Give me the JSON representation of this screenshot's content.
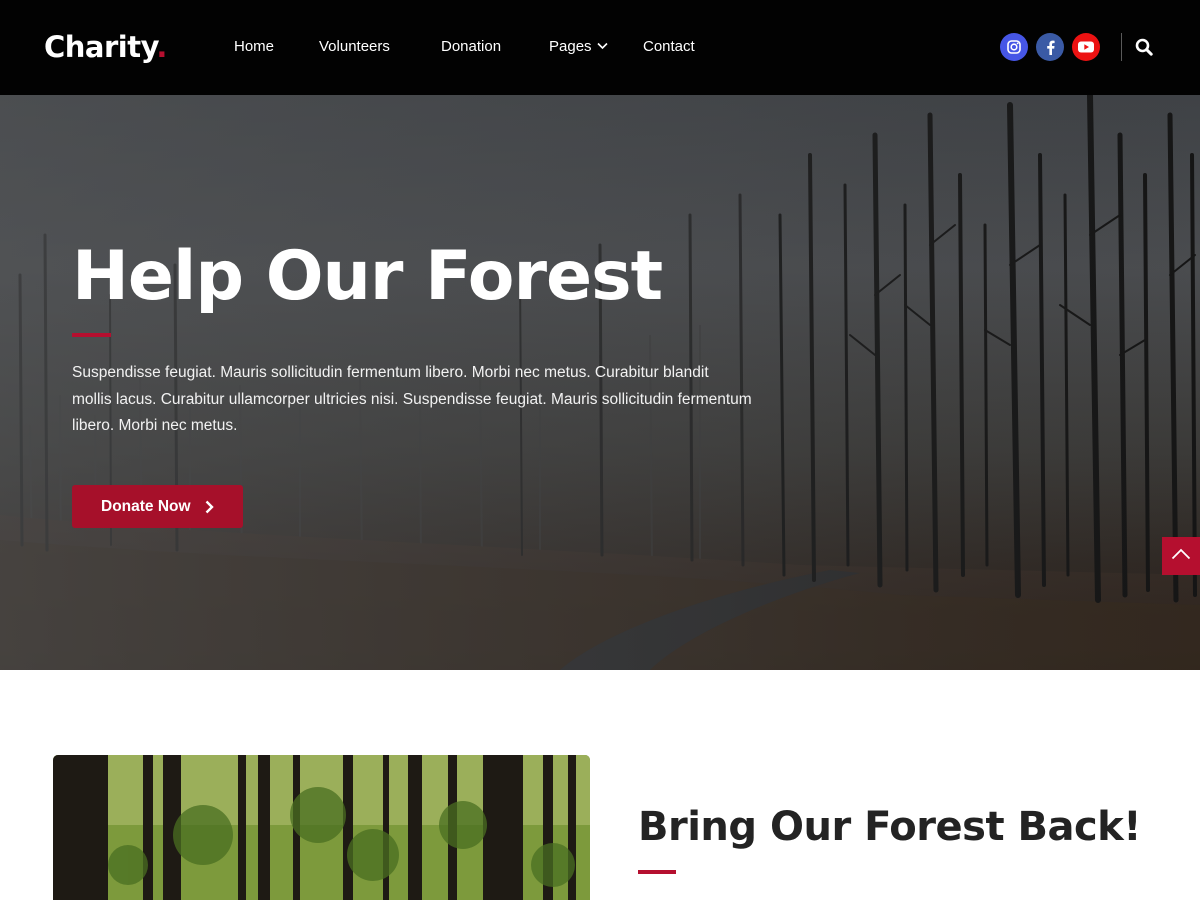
{
  "header": {
    "logo_text": "Charity",
    "logo_dot": ".",
    "nav": [
      {
        "label": "Home"
      },
      {
        "label": "Volunteers"
      },
      {
        "label": "Donation"
      },
      {
        "label": "Pages",
        "has_dropdown": true
      },
      {
        "label": "Contact"
      }
    ],
    "social": [
      {
        "icon": "instagram-icon",
        "color": "#4656e6"
      },
      {
        "icon": "facebook-icon",
        "color": "#3a5aa5"
      },
      {
        "icon": "youtube-icon",
        "color": "#ec1212"
      }
    ],
    "search_icon": "search-icon"
  },
  "hero": {
    "title": "Help Our Forest",
    "text": "Suspendisse feugiat. Mauris sollicitudin fermentum libero. Morbi nec metus. Curabitur blandit mollis lacus. Curabitur ullamcorper ultricies nisi. Suspendisse feugiat. Mauris sollicitudin fermentum libero. Morbi nec metus.",
    "button_label": "Donate Now",
    "button_icon": "chevron-right-icon"
  },
  "scroll_top_icon": "chevron-up-icon",
  "section": {
    "title": "Bring Our Forest Back!"
  },
  "colors": {
    "accent": "#b50f2f",
    "button": "#a6102a",
    "header_bg": "#020202"
  }
}
